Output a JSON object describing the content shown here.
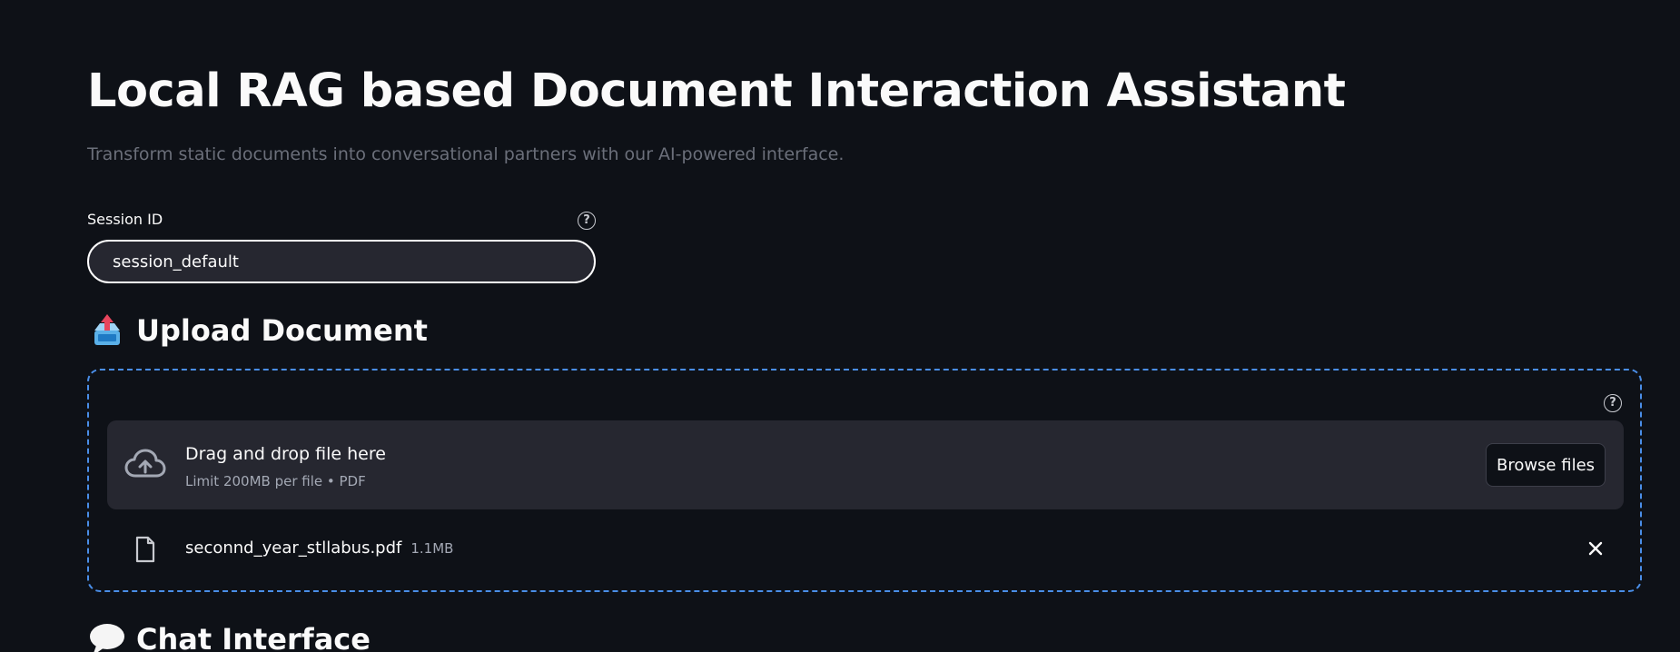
{
  "header": {
    "title": "Local RAG based Document Interaction Assistant",
    "subtitle": "Transform static documents into conversational partners with our AI-powered interface."
  },
  "session": {
    "label": "Session ID",
    "value": "session_default",
    "help_icon": "question-circle-icon"
  },
  "upload": {
    "heading": "Upload Document",
    "heading_icon": "inbox-tray-emoji-icon",
    "help_icon": "question-circle-icon",
    "dropzone_title": "Drag and drop file here",
    "dropzone_limit": "Limit 200MB per file • PDF",
    "browse_label": "Browse files",
    "cloud_icon": "cloud-upload-icon",
    "file": {
      "name": "seconnd_year_stllabus.pdf",
      "size": "1.1MB",
      "icon": "file-icon",
      "remove_icon": "close-icon"
    }
  },
  "chat": {
    "heading": "Chat Interface",
    "heading_icon": "speech-balloon-emoji-icon"
  },
  "colors": {
    "background": "#0e1117",
    "input_bg": "#262730",
    "dropzone_border": "#4a8ee8",
    "muted_text": "#6b6f7a"
  }
}
